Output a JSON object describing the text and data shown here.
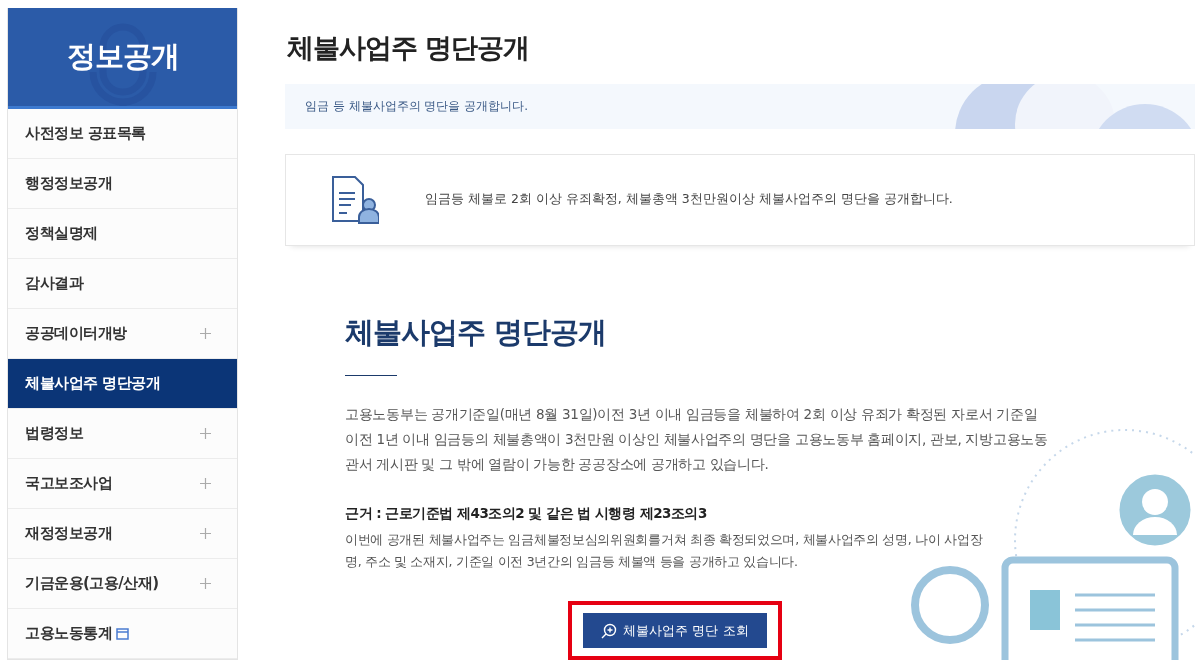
{
  "sidebar": {
    "title": "정보공개",
    "items": [
      {
        "label": "사전정보 공표목록",
        "selected": false,
        "kind": "plain"
      },
      {
        "label": "행정정보공개",
        "selected": false,
        "kind": "plain"
      },
      {
        "label": "정책실명제",
        "selected": false,
        "kind": "plain"
      },
      {
        "label": "감사결과",
        "selected": false,
        "kind": "plain"
      },
      {
        "label": "공공데이터개방",
        "selected": false,
        "kind": "expand"
      },
      {
        "label": "체불사업주 명단공개",
        "selected": true,
        "kind": "plain"
      },
      {
        "label": "법령정보",
        "selected": false,
        "kind": "expand"
      },
      {
        "label": "국고보조사업",
        "selected": false,
        "kind": "expand"
      },
      {
        "label": "재정정보공개",
        "selected": false,
        "kind": "expand"
      },
      {
        "label": "기금운용(고용/산재)",
        "selected": false,
        "kind": "expand"
      },
      {
        "label": "고용노동통계",
        "selected": false,
        "kind": "external"
      }
    ]
  },
  "page": {
    "title": "체불사업주 명단공개",
    "banner": "임금 등 체불사업주의 명단을 공개합니다.",
    "notice": "임금등 체불로 2회 이상 유죄확정, 체불총액 3천만원이상 체불사업주의 명단을 공개합니다.",
    "section": {
      "heading": "체불사업주 명단공개",
      "paragraph": "고용노동부는 공개기준일(매년 8월 31일)이전 3년 이내 임금등을 체불하여 2회 이상 유죄가 확정된 자로서 기준일 이전 1년 이내 임금등의 체불총액이 3천만원 이상인 체불사업주의 명단을 고용노동부 홈페이지, 관보, 지방고용노동관서 게시판 및 그 밖에 열람이 가능한 공공장소에 공개하고 있습니다.",
      "basis_title": "근거 : 근로기준법 제43조의2 및 같은 법 시행령 제23조의3",
      "basis_text": "이번에 공개된 체불사업주는 임금체불정보심의위원회를거쳐 최종 확정되었으며, 체불사업주의 성명, 나이 사업장명, 주소 및 소재지, 기준일 이전 3년간의 임금등 체불액 등을 공개하고 있습니다.",
      "button": {
        "label": "체불사업주 명단 조회",
        "highlighted": true
      }
    }
  }
}
